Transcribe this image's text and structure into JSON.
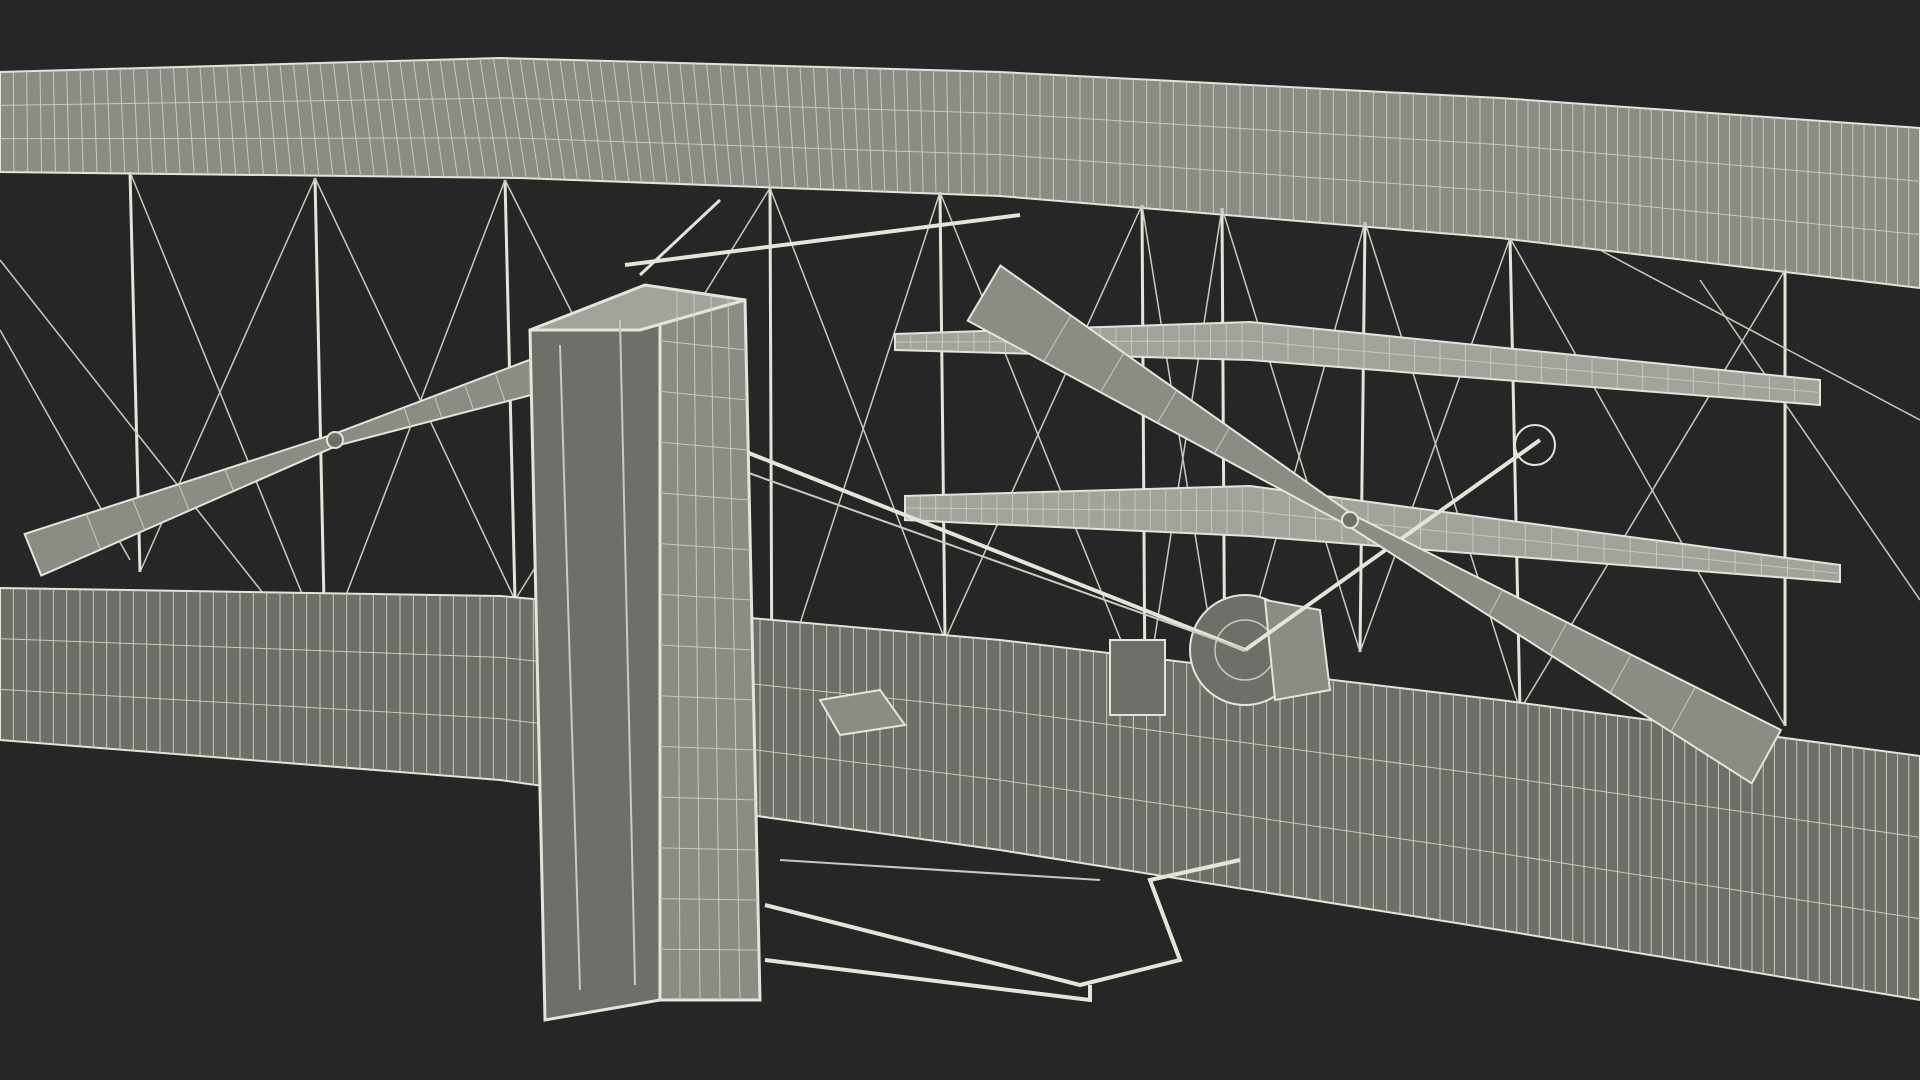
{
  "scene": {
    "subject": "wright-flyer-wireframe-render",
    "colors": {
      "background": "#262626",
      "surface_fill": "#8c8c85",
      "surface_fill_dark": "#6f6f69",
      "surface_fill_light": "#a3a39b",
      "wire": "#e4e4d9",
      "wire_faint": "#c9c9be"
    }
  }
}
